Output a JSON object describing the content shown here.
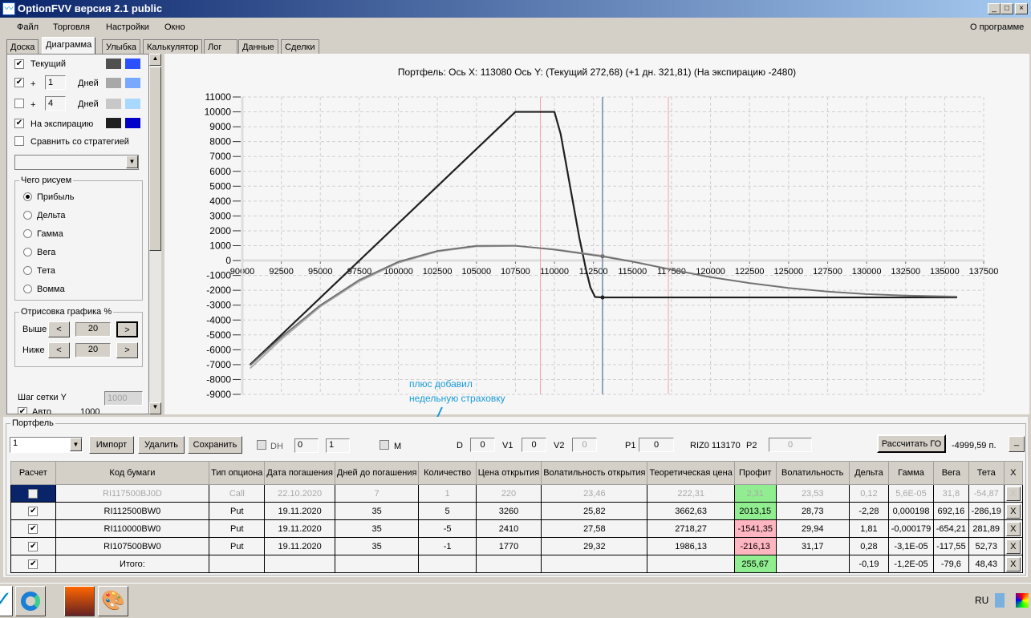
{
  "window": {
    "title": "OptionFVV версия 2.1 public",
    "logo": "chart-logo-icon"
  },
  "menu": [
    "Файл",
    "Торговля",
    "Настройки",
    "Окно"
  ],
  "menu_right": "О программе",
  "tabs": [
    "Доска",
    "Диаграмма",
    "Улыбка",
    "Калькулятор",
    "Лог",
    "Данные",
    "Сделки"
  ],
  "active_tab": 1,
  "left": {
    "current_label": "Текущий",
    "current_checked": true,
    "current_colors": [
      "#505050",
      "#2a50ff"
    ],
    "plus1_prefix": "+",
    "plus1_value": "1",
    "plus1_unit": "Дней",
    "plus1_checked": true,
    "plus1_colors": [
      "#a8a8a8",
      "#78a8ff"
    ],
    "plus2_prefix": "+",
    "plus2_value": "4",
    "plus2_unit": "Дней",
    "plus2_checked": false,
    "plus2_colors": [
      "#c8c8c8",
      "#a8d8ff"
    ],
    "exp_label": "На экспирацию",
    "exp_checked": true,
    "exp_colors": [
      "#202020",
      "#0000c8"
    ],
    "compare_label": "Сравнить со стратегией",
    "what_title": "Чего рисуем",
    "what_options": [
      "Прибыль",
      "Дельта",
      "Гамма",
      "Вега",
      "Тета",
      "Вомма"
    ],
    "what_selected": 0,
    "draw_title": "Отрисовка графика %",
    "above_label": "Выше",
    "above_value": "20",
    "below_label": "Ниже",
    "below_value": "20",
    "grid_label": "Шаг сетки Y",
    "grid_value": "1000",
    "auto_label": "Авто",
    "auto_value": "1000"
  },
  "chart_data": {
    "type": "line",
    "title": "Портфель: Ось X: 113080 Ось Y:  (Текущий 272,68)  (+1 дн. 321,81)  (На экспирацию -2480)",
    "xlim": [
      90000,
      137500
    ],
    "ylim": [
      -9000,
      11000
    ],
    "xticks": [
      90000,
      92500,
      95000,
      97500,
      100000,
      102500,
      105000,
      107500,
      110000,
      112500,
      115000,
      117500,
      120000,
      122500,
      125000,
      127500,
      130000,
      132500,
      135000,
      137500
    ],
    "yticks": [
      11000,
      10000,
      9000,
      8000,
      7000,
      6000,
      5000,
      4000,
      3000,
      2000,
      1000,
      0,
      -1000,
      -2000,
      -3000,
      -4000,
      -5000,
      -6000,
      -7000,
      -8000,
      -9000
    ],
    "grid": true,
    "cursor_x": 113080,
    "markers_x": [
      109100,
      117300
    ],
    "series": [
      {
        "name": "На экспирацию",
        "color": "#202020",
        "points": [
          [
            90500,
            -7000
          ],
          [
            107500,
            10000
          ],
          [
            110000,
            10000
          ],
          [
            110400,
            8500
          ],
          [
            111000,
            5000
          ],
          [
            111600,
            1500
          ],
          [
            112000,
            -500
          ],
          [
            112300,
            -1800
          ],
          [
            112600,
            -2450
          ],
          [
            113080,
            -2480
          ],
          [
            135800,
            -2480
          ]
        ]
      },
      {
        "name": "+1 дн.",
        "color": "#a8a8a8",
        "points": [
          [
            90500,
            -7250
          ],
          [
            92500,
            -5300
          ],
          [
            95000,
            -3100
          ],
          [
            97500,
            -1400
          ],
          [
            100000,
            -150
          ],
          [
            102500,
            600
          ],
          [
            105000,
            950
          ],
          [
            107500,
            980
          ],
          [
            110000,
            760
          ],
          [
            113080,
            322
          ],
          [
            115000,
            -50
          ],
          [
            117500,
            -600
          ],
          [
            120000,
            -1100
          ],
          [
            122500,
            -1500
          ],
          [
            125000,
            -1830
          ],
          [
            127500,
            -2080
          ],
          [
            130000,
            -2250
          ],
          [
            132500,
            -2350
          ],
          [
            135800,
            -2420
          ]
        ]
      },
      {
        "name": "Текущий",
        "color": "#707070",
        "points": [
          [
            90500,
            -7050
          ],
          [
            92500,
            -5150
          ],
          [
            95000,
            -3000
          ],
          [
            97500,
            -1300
          ],
          [
            100000,
            -80
          ],
          [
            102500,
            650
          ],
          [
            105000,
            990
          ],
          [
            107500,
            1000
          ],
          [
            110000,
            730
          ],
          [
            113080,
            273
          ],
          [
            115000,
            -80
          ],
          [
            117500,
            -620
          ],
          [
            120000,
            -1120
          ],
          [
            122500,
            -1520
          ],
          [
            125000,
            -1850
          ],
          [
            127500,
            -2090
          ],
          [
            130000,
            -2260
          ],
          [
            132500,
            -2360
          ],
          [
            135800,
            -2430
          ]
        ]
      }
    ]
  },
  "annotation": {
    "line1": "плюс добавил",
    "line2": "недельную страховку",
    "color": "#1a9ad8"
  },
  "portfolio": {
    "title": "Портфель",
    "select_value": "1",
    "import": "Импорт",
    "delete": "Удалить",
    "save": "Сохранить",
    "dh_label": "DH",
    "dh_spin1": "0",
    "dh_spin2": "1",
    "m_label": "M",
    "d_label": "D",
    "d_value": "0",
    "v1_label": "V1",
    "v1_value": "0",
    "v2_label": "V2",
    "v2_value": "0",
    "p1_label": "P1",
    "p1_value": "0",
    "riz_label": "RIZ0 113170",
    "p2_label": "P2",
    "p2_value": "0",
    "calc_go": "Рассчитать ГО",
    "go_value": "-4999,59 п.",
    "minimize": "_"
  },
  "table": {
    "headers": [
      "Расчет",
      "Код бумаги",
      "Тип опциона",
      "Дата погашения",
      "Дней до погашения",
      "Количество",
      "Цена открытия",
      "Волатильность открытия",
      "Теоретическая цена",
      "Профит",
      "Волатильность",
      "Дельта",
      "Гамма",
      "Вега",
      "Тета",
      "X"
    ],
    "rows": [
      {
        "checked": false,
        "disabled": true,
        "cells": [
          "RI117500BJ0D",
          "Call",
          "22.10.2020",
          "7",
          "1",
          "220",
          "23,46",
          "222,31",
          "2,31",
          "23,53",
          "0,12",
          "5,6E-05",
          "31,8",
          "-54,87"
        ],
        "profit": "green"
      },
      {
        "checked": true,
        "cells": [
          "RI112500BW0",
          "Put",
          "19.11.2020",
          "35",
          "5",
          "3260",
          "25,82",
          "3662,63",
          "2013,15",
          "28,73",
          "-2,28",
          "0,000198",
          "692,16",
          "-286,19"
        ],
        "profit": "green"
      },
      {
        "checked": true,
        "cells": [
          "RI110000BW0",
          "Put",
          "19.11.2020",
          "35",
          "-5",
          "2410",
          "27,58",
          "2718,27",
          "-1541,35",
          "29,94",
          "1,81",
          "-0,000179",
          "-654,21",
          "281,89"
        ],
        "profit": "red"
      },
      {
        "checked": true,
        "cells": [
          "RI107500BW0",
          "Put",
          "19.11.2020",
          "35",
          "-1",
          "1770",
          "29,32",
          "1986,13",
          "-216,13",
          "31,17",
          "0,28",
          "-3,1E-05",
          "-117,55",
          "52,73"
        ],
        "profit": "red"
      },
      {
        "checked": true,
        "cells": [
          "Итого:",
          "",
          "",
          "",
          "",
          "",
          "",
          "",
          "255,67",
          "",
          "-0,19",
          "-1,2E-05",
          "-79,6",
          "48,43"
        ],
        "profit": "green"
      }
    ],
    "delete_label": "X"
  },
  "taskbar": {
    "apps": [
      "optionfvv-icon",
      "edge-icon",
      "game-icon",
      "paint-icon"
    ],
    "lang": "RU"
  }
}
